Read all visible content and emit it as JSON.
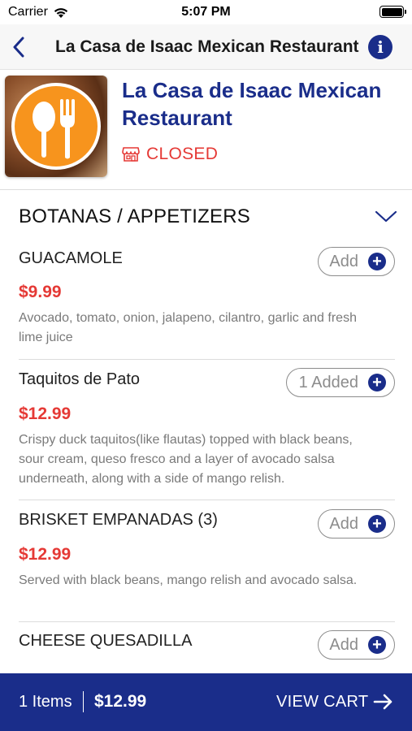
{
  "status_bar": {
    "carrier": "Carrier",
    "time": "5:07 PM"
  },
  "nav": {
    "title": "La Casa de Isaac Mexican Restaurant",
    "info_glyph": "i"
  },
  "restaurant": {
    "name": "La Casa de Isaac Mexican Restaurant",
    "status": "CLOSED",
    "status_icon": "storefront-icon",
    "logo_icon": "spoon-fork-icon"
  },
  "section": {
    "title": "BOTANAS / APPETIZERS",
    "toggle_icon": "chevron-down-icon"
  },
  "items": [
    {
      "name": "GUACAMOLE",
      "price": "$9.99",
      "description": "Avocado, tomato, onion, jalapeno, cilantro, garlic and fresh lime juice",
      "button": "Add"
    },
    {
      "name": "Taquitos de Pato",
      "price": "$12.99",
      "description": "Crispy duck taquitos(like flautas) topped with black beans, sour cream, queso fresco and a layer of avocado salsa underneath, along with a side of mango relish.",
      "button": "1 Added"
    },
    {
      "name": "BRISKET EMPANADAS (3)",
      "price": "$12.99",
      "description": "Served with black beans, mango relish and avocado salsa.",
      "button": "Add"
    },
    {
      "name": "CHEESE QUESADILLA",
      "price": "",
      "description": "",
      "button": "Add"
    }
  ],
  "cart": {
    "count": "1 Items",
    "total": "$12.99",
    "view_label": "VIEW CART"
  },
  "colors": {
    "primary": "#1a2d8a",
    "price": "#e53935",
    "closed": "#e53935",
    "logo_orange": "#f7941d"
  }
}
